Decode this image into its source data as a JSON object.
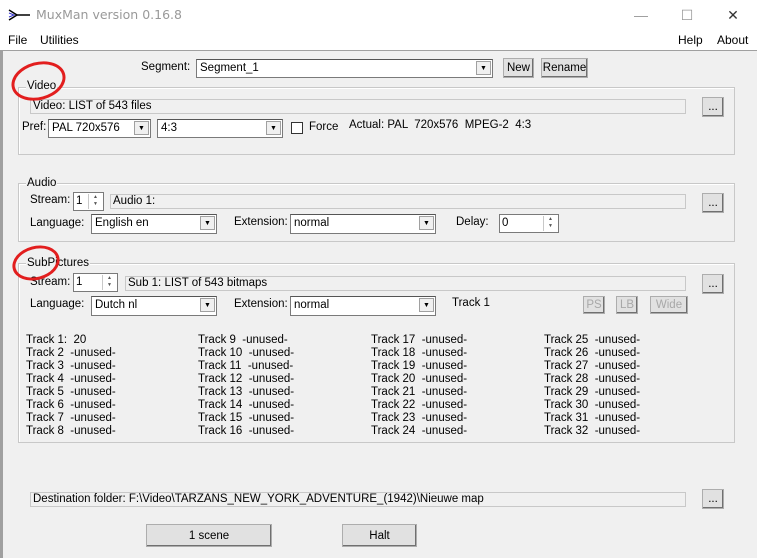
{
  "window": {
    "title": "MuxMan version 0.16.8",
    "minimize": "—",
    "maximize": "☐",
    "close": "✕"
  },
  "menu": {
    "left": [
      "File",
      "Utilities"
    ],
    "right": [
      "Help",
      "About"
    ]
  },
  "segment": {
    "label": "Segment:",
    "value": "Segment_1",
    "new": "New",
    "rename": "Rename"
  },
  "video": {
    "group": "Video",
    "info": "Video: LIST of 543 files",
    "browse": "...",
    "pref_label": "Pref:",
    "pref_value": "PAL  720x576",
    "aspect": "4:3",
    "force": "Force",
    "force_checked": false,
    "actual": "Actual: PAL  720x576  MPEG-2  4:3"
  },
  "audio": {
    "group": "Audio",
    "stream_label": "Stream:",
    "stream": "1",
    "info": "Audio 1:",
    "browse": "...",
    "language_label": "Language:",
    "language": "English en",
    "extension_label": "Extension:",
    "extension": "normal",
    "delay_label": "Delay:",
    "delay": "0"
  },
  "subpictures": {
    "group": "SubPictures",
    "stream_label": "Stream:",
    "stream": "1",
    "info": "Sub 1: LIST of 543 bitmaps",
    "browse": "...",
    "language_label": "Language:",
    "language": "Dutch nl",
    "extension_label": "Extension:",
    "extension": "normal",
    "track": "Track 1",
    "ps": "PS",
    "lb": "LB",
    "wide": "Wide",
    "tracks": [
      [
        "Track 1:  20",
        "Track 2  -unused-",
        "Track 3  -unused-",
        "Track 4  -unused-",
        "Track 5  -unused-",
        "Track 6  -unused-",
        "Track 7  -unused-",
        "Track 8  -unused-"
      ],
      [
        "Track 9  -unused-",
        "Track 10  -unused-",
        "Track 11  -unused-",
        "Track 12  -unused-",
        "Track 13  -unused-",
        "Track 14  -unused-",
        "Track 15  -unused-",
        "Track 16  -unused-"
      ],
      [
        "Track 17  -unused-",
        "Track 18  -unused-",
        "Track 19  -unused-",
        "Track 20  -unused-",
        "Track 21  -unused-",
        "Track 22  -unused-",
        "Track 23  -unused-",
        "Track 24  -unused-"
      ],
      [
        "Track 25  -unused-",
        "Track 26  -unused-",
        "Track 27  -unused-",
        "Track 28  -unused-",
        "Track 29  -unused-",
        "Track 30  -unused-",
        "Track 31  -unused-",
        "Track 32  -unused-"
      ]
    ]
  },
  "destination": {
    "text": "Destination folder: F:\\Video\\TARZANS_NEW_YORK_ADVENTURE_(1942)\\Nieuwe map",
    "browse": "..."
  },
  "actions": {
    "scene": "1 scene",
    "halt": "Halt"
  }
}
